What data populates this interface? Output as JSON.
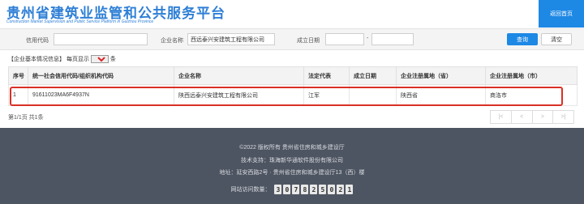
{
  "header": {
    "title": "贵州省建筑业监管和公共服务平台",
    "subtitle": "Construction Market Supervision and Public Service Platform in Guizhou Province",
    "home_button": "返回首页"
  },
  "search": {
    "credit_code_label": "信用代码",
    "credit_code_value": "",
    "company_name_label": "企业名称",
    "company_name_value": "西远泰兴安建筑工程有限公司",
    "established_label": "成立日期",
    "established_from": "",
    "established_to": "",
    "range_separator": "-",
    "query_button": "查询",
    "clear_button": "清空"
  },
  "list_info": {
    "title": "【企业基本情况信息】",
    "page_size_label": "每页显示",
    "page_size_value": "99",
    "page_size_unit": "条"
  },
  "table": {
    "headers": [
      "序号",
      "统一社会信用代码/组织机构代码",
      "企业名称",
      "法定代表",
      "成立日期",
      "企业注册属地（省）",
      "企业注册属地（市）"
    ],
    "rows": [
      [
        "1",
        "91611023MA6F4937N",
        "陕西远泰兴安建筑工程有限公司",
        "江军",
        "",
        "陕西省",
        "商洛市"
      ]
    ]
  },
  "pagination": {
    "info": "第1/1页 共1条",
    "first": "|<",
    "prev": "<",
    "next": ">",
    "last": ">|"
  },
  "footer": {
    "copyright": "©2022 版权所有 贵州省住房和城乡建设厅",
    "support": "技术支持：珠海新华通软件股份有限公司",
    "address": "地址：延安西路2号 · 贵州省住房和城乡建设厅13（西）楼",
    "visits_label": "网站访问数量：",
    "visits_digits": [
      "3",
      "0",
      "7",
      "8",
      "2",
      "5",
      "0",
      "2",
      "1"
    ]
  },
  "colors": {
    "accent": "#1e88e5",
    "highlight_border": "#d93025",
    "footer_bg": "#4e5562"
  }
}
